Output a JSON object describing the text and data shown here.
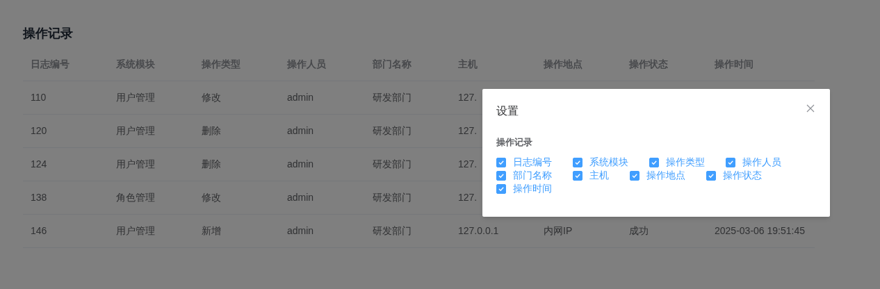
{
  "page_title": "操作记录",
  "table": {
    "columns": [
      "日志编号",
      "系统模块",
      "操作类型",
      "操作人员",
      "部门名称",
      "主机",
      "操作地点",
      "操作状态",
      "操作时间"
    ],
    "rows": [
      {
        "cells": [
          "110",
          "用户管理",
          "修改",
          "admin",
          "研发部门",
          "127."
        ]
      },
      {
        "cells": [
          "120",
          "用户管理",
          "删除",
          "admin",
          "研发部门",
          "127."
        ]
      },
      {
        "cells": [
          "124",
          "用户管理",
          "删除",
          "admin",
          "研发部门",
          "127."
        ]
      },
      {
        "cells": [
          "138",
          "角色管理",
          "修改",
          "admin",
          "研发部门",
          "127."
        ]
      },
      {
        "cells": [
          "146",
          "用户管理",
          "新增",
          "admin",
          "研发部门",
          "127.0.0.1",
          "内网IP",
          "成功",
          "2025-03-06 19:51:45"
        ]
      }
    ]
  },
  "dialog": {
    "title": "设置",
    "section_title": "操作记录",
    "options": [
      {
        "label": "日志编号",
        "checked": true
      },
      {
        "label": "系统模块",
        "checked": true
      },
      {
        "label": "操作类型",
        "checked": true
      },
      {
        "label": "操作人员",
        "checked": true
      },
      {
        "label": "部门名称",
        "checked": true
      },
      {
        "label": "主机",
        "checked": true
      },
      {
        "label": "操作地点",
        "checked": true
      },
      {
        "label": "操作状态",
        "checked": true
      },
      {
        "label": "操作时间",
        "checked": true
      }
    ]
  }
}
